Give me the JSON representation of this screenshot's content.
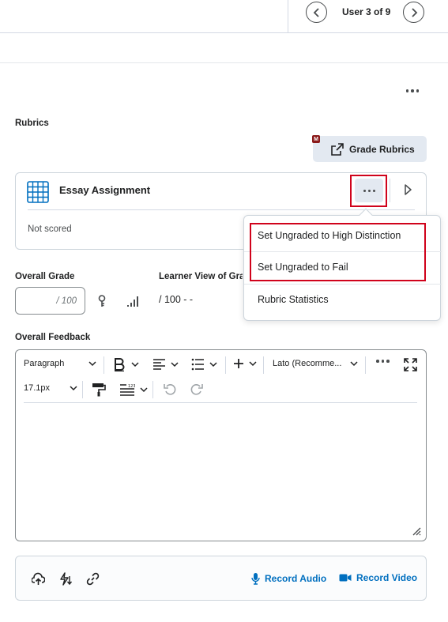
{
  "header": {
    "user_position": "User 3 of 9"
  },
  "rubrics": {
    "section_label": "Rubrics",
    "grade_rubrics_label": "Grade Rubrics",
    "badge_letter": "M",
    "card": {
      "title": "Essay Assignment",
      "status": "Not scored"
    },
    "menu": {
      "items": [
        "Set Ungraded to High Distinction",
        "Set Ungraded to Fail",
        "Rubric Statistics"
      ]
    }
  },
  "grade": {
    "overall_label": "Overall Grade",
    "input_placeholder": "/ 100",
    "learner_view_label": "Learner View of Grac",
    "learner_view_value": "/ 100 - -"
  },
  "feedback": {
    "label": "Overall Feedback",
    "toolbar": {
      "block_format": "Paragraph",
      "font": "Lato (Recomme...",
      "font_size": "17.1px"
    }
  },
  "attachments": {
    "record_audio": "Record Audio",
    "record_video": "Record Video"
  },
  "colors": {
    "accent": "#006fbf",
    "highlight": "#d0021b",
    "button_bg": "#e3e9f1"
  }
}
